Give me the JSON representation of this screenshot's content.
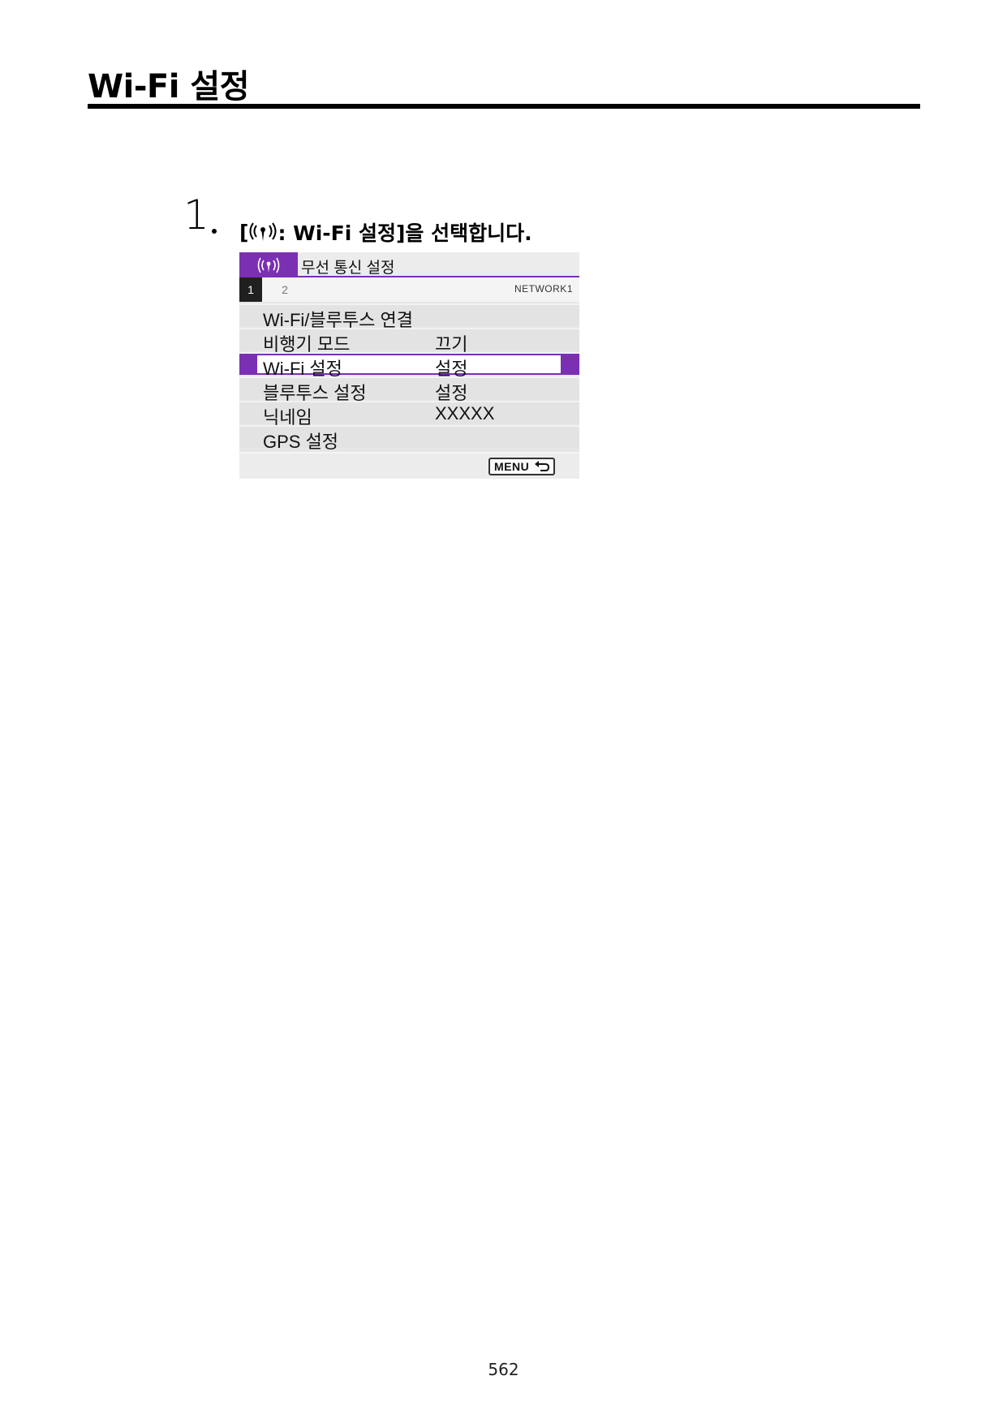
{
  "document": {
    "title": "Wi-Fi 설정",
    "page_number": "562"
  },
  "step": {
    "number": "1",
    "text_prefix": "[",
    "icon": "wireless-antenna-icon",
    "text_suffix": ": Wi-Fi 설정]을 선택합니다."
  },
  "camera_screen": {
    "tab_icon": "wireless-antenna-icon",
    "menu_title": "무선 통신 설정",
    "pages": [
      "1",
      "2"
    ],
    "network_label": "NETWORK1",
    "items": [
      {
        "label": "Wi-Fi/블루투스 연결",
        "value": ""
      },
      {
        "label": "비행기 모드",
        "value": "끄기"
      },
      {
        "label": "Wi-Fi 설정",
        "value": "설정",
        "selected": true
      },
      {
        "label": "블루투스 설정",
        "value": "설정"
      },
      {
        "label": "닉네임",
        "value": "XXXXX"
      },
      {
        "label": "GPS 설정",
        "value": ""
      }
    ],
    "menu_button_label": "MENU",
    "accent_color": "#7b2fb3"
  }
}
